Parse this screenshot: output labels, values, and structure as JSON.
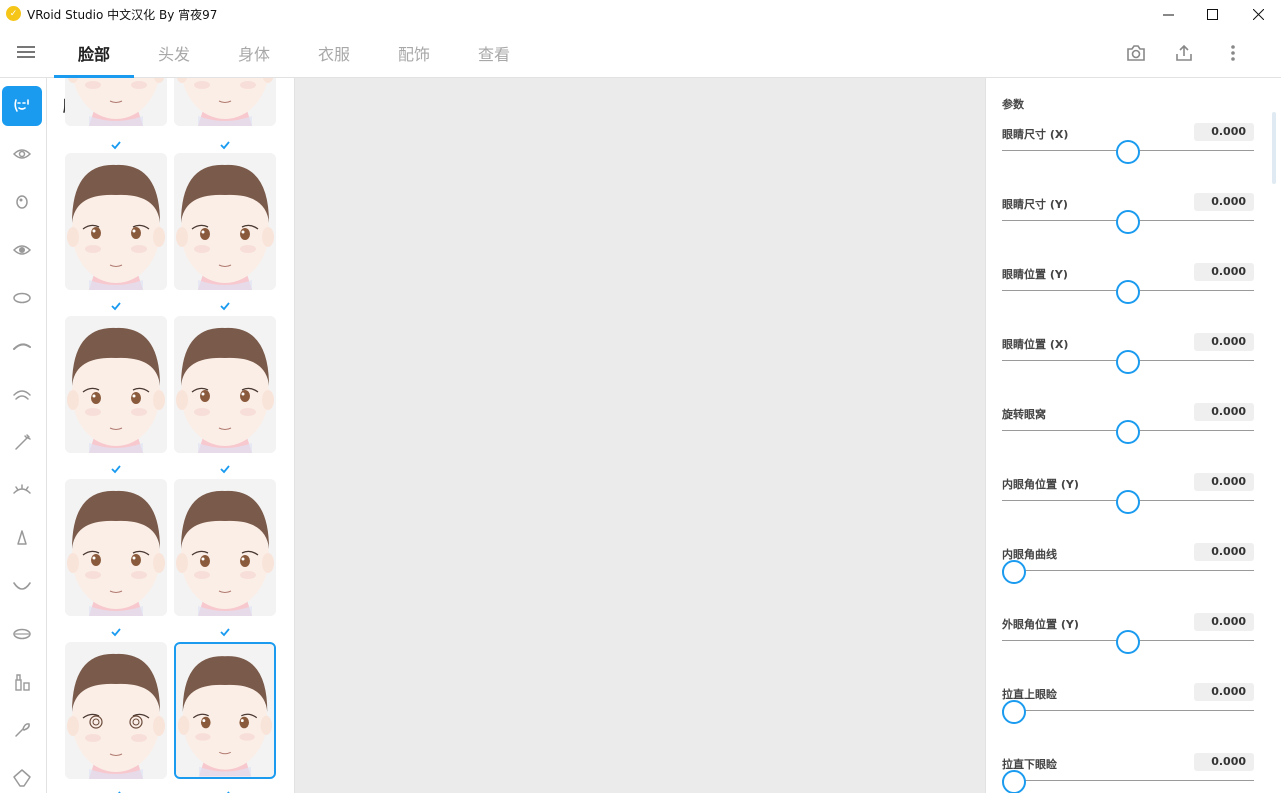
{
  "window": {
    "title": "VRoid Studio 中文汉化 By 宵夜97",
    "minimize_label": "─",
    "maximize_label": "☐",
    "close_label": "✕"
  },
  "tabs": [
    {
      "label": "脸部",
      "active": true
    },
    {
      "label": "头发",
      "active": false
    },
    {
      "label": "身体",
      "active": false
    },
    {
      "label": "衣服",
      "active": false
    },
    {
      "label": "配饰",
      "active": false
    },
    {
      "label": "查看",
      "active": false
    }
  ],
  "toolbar": {
    "icons": [
      "camera-icon",
      "export-icon",
      "more-vertical-icon"
    ]
  },
  "sidebar": {
    "items": [
      {
        "icon": "face-icon",
        "active": true
      },
      {
        "icon": "eye-icon",
        "active": false
      },
      {
        "icon": "iris-icon",
        "active": false
      },
      {
        "icon": "eye-highlight-icon",
        "active": false
      },
      {
        "icon": "eye-white-icon",
        "active": false
      },
      {
        "icon": "eyebrow-icon",
        "active": false
      },
      {
        "icon": "eyelid-icon",
        "active": false
      },
      {
        "icon": "eyelash-icon",
        "active": false
      },
      {
        "icon": "eyeline-icon",
        "active": false
      },
      {
        "icon": "nose-icon",
        "active": false
      },
      {
        "icon": "mouth-icon",
        "active": false
      },
      {
        "icon": "teeth-icon",
        "active": false
      },
      {
        "icon": "makeup-icon",
        "active": false
      },
      {
        "icon": "brush-icon",
        "active": false
      },
      {
        "icon": "face-outline-icon",
        "active": false
      }
    ]
  },
  "presets": {
    "title": "脸型",
    "checkmark": "✓",
    "selected_index": 7
  },
  "params": {
    "section_title": "参数",
    "items": [
      {
        "label": "眼睛尺寸 (X)",
        "value": "0.000",
        "level": 0.5
      },
      {
        "label": "眼睛尺寸 (Y)",
        "value": "0.000",
        "level": 0.5
      },
      {
        "label": "眼睛位置 (Y)",
        "value": "0.000",
        "level": 0.5
      },
      {
        "label": "眼睛位置 (X)",
        "value": "0.000",
        "level": 0.5
      },
      {
        "label": "旋转眼窝",
        "value": "0.000",
        "level": 0.5
      },
      {
        "label": "内眼角位置 (Y)",
        "value": "0.000",
        "level": 0.5
      },
      {
        "label": "内眼角曲线",
        "value": "0.000",
        "level": 0.0
      },
      {
        "label": "外眼角位置 (Y)",
        "value": "0.000",
        "level": 0.5
      },
      {
        "label": "拉直上眼睑",
        "value": "0.000",
        "level": 0.0
      },
      {
        "label": "拉直下眼睑",
        "value": "0.000",
        "level": 0.0
      }
    ]
  },
  "colors": {
    "accent": "#1a9bf0",
    "viewport_bg": "#ebebeb"
  }
}
